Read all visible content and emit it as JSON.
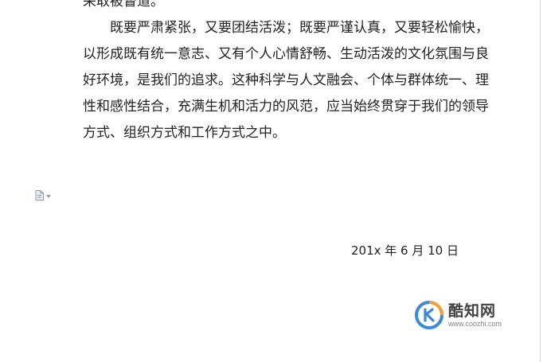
{
  "document": {
    "cut_line": "采取被督道。",
    "paragraph_lines": [
      "既要严肃紧张，又要团结活泼；既要严谨认真，又要轻松愉快，",
      "以形成既有统一意志、又有个人心情舒畅、生动活泼的文化氛围与良",
      "好环境，是我们的追求。这种科学与人文融会、个体与群体统一、理",
      "性和感性结合，充满生机和活力的风范，应当始终贯穿于我们的领导",
      "方式、组织方式和工作方式之中。"
    ],
    "date": "201x 年 6 月 10 日"
  },
  "paste_options": {
    "icon": "paste-options-icon",
    "dropdown_icon": "chevron-down-icon"
  },
  "watermark": {
    "name": "酷知网",
    "url": "www.coozhi.com",
    "colors": {
      "blue": "#2b7fd4",
      "orange": "#f39a1e"
    }
  }
}
